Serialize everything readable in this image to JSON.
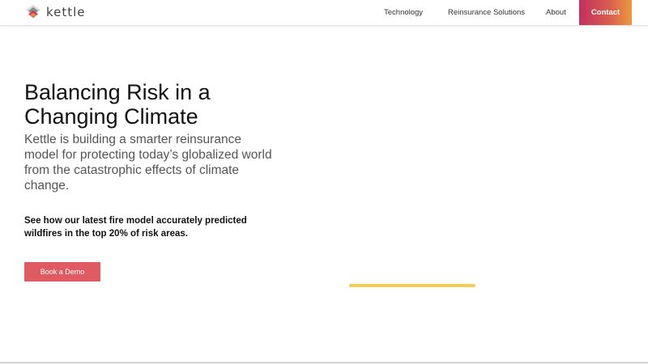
{
  "header": {
    "logo_text": "kettle",
    "nav": {
      "technology": "Technology",
      "reinsurance_solutions": "Reinsurance Solutions",
      "about": "About",
      "contact": "Contact"
    },
    "contact_gradient": [
      "#c2305e",
      "#eb9a3e"
    ]
  },
  "hero": {
    "title": "Balancing Risk in a Changing Climate",
    "description": "Kettle is building a smarter reinsurance model for protecting today’s globalized world from the catastrophic effects of climate change.",
    "note": "See how our latest fire model accurately predicted wildfires in the top 20% of risk areas.",
    "cta_label": "Book a Demo",
    "cta_color": "#e05a62"
  },
  "loader": {
    "progress": 1.0,
    "color": "#f7cc52"
  },
  "icons": {
    "logo": "layered-diamond-logo-icon"
  }
}
